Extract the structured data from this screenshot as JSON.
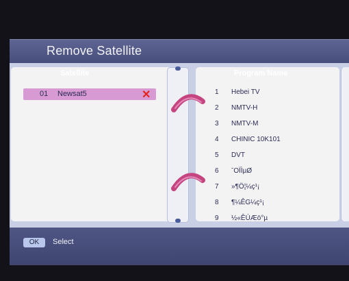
{
  "header": {
    "title": "Remove Satellite"
  },
  "satellite_panel": {
    "header": "Satellite",
    "items": [
      {
        "number": "01",
        "name": "Newsat5",
        "status_icon": "delete-x-icon",
        "marked_color": "#e2241d"
      }
    ]
  },
  "program_panel": {
    "header": "Program Name",
    "items": [
      {
        "number": "1",
        "name": "Hebei TV"
      },
      {
        "number": "2",
        "name": "NMTV-H"
      },
      {
        "number": "3",
        "name": "NMTV-M"
      },
      {
        "number": "4",
        "name": "CHINIC 10K101"
      },
      {
        "number": "5",
        "name": "DVT"
      },
      {
        "number": "6",
        "name": "ˉOÏÌµØ"
      },
      {
        "number": "7",
        "name": "»¶Ö¦¼ç¹¡"
      },
      {
        "number": "8",
        "name": "¶¼ÊG¼ç¹¡"
      },
      {
        "number": "9",
        "name": "½«ÊÚÆö°µ"
      }
    ]
  },
  "footer": {
    "key": "OK",
    "action": "Select"
  },
  "colors": {
    "title_bar": "#4f5684",
    "panel_bg": "#c9d0e6",
    "selected_row": "#d79ad3",
    "ring_binder": "#c4457f"
  }
}
